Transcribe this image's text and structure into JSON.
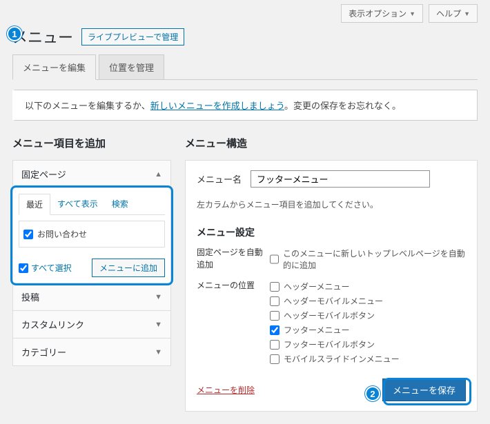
{
  "topbar": {
    "screen_options": "表示オプション",
    "help": "ヘルプ"
  },
  "heading": "メニュー",
  "live_preview_btn": "ライブプレビューで管理",
  "tabs": {
    "edit": "メニューを編集",
    "locations": "位置を管理"
  },
  "notice": {
    "pre": "以下のメニューを編集するか、",
    "link": "新しいメニューを作成しましょう",
    "post": "。変更の保存をお忘れなく。"
  },
  "left": {
    "title": "メニュー項目を追加",
    "acc": {
      "pages": "固定ページ",
      "posts": "投稿",
      "custom": "カスタムリンク",
      "categories": "カテゴリー"
    },
    "inner_tabs": {
      "recent": "最近",
      "all": "すべて表示",
      "search": "検索"
    },
    "item_contact": "お問い合わせ",
    "select_all": "すべて選択",
    "add_btn": "メニューに追加"
  },
  "right": {
    "title": "メニュー構造",
    "name_label": "メニュー名",
    "name_value": "フッターメニュー",
    "hint": "左カラムからメニュー項目を追加してください。",
    "settings_h": "メニュー設定",
    "auto_add_label": "固定ページを自動追加",
    "auto_add_opt": "このメニューに新しいトップレベルページを自動的に追加",
    "loc_label": "メニューの位置",
    "locs": {
      "header": "ヘッダーメニュー",
      "header_mobile": "ヘッダーモバイルメニュー",
      "header_mobile_btn": "ヘッダーモバイルボタン",
      "footer": "フッターメニュー",
      "footer_mobile_btn": "フッターモバイルボタン",
      "mobile_slidein": "モバイルスライドインメニュー"
    },
    "delete": "メニューを削除",
    "save": "メニューを保存"
  },
  "callouts": {
    "one": "1",
    "two": "2"
  }
}
